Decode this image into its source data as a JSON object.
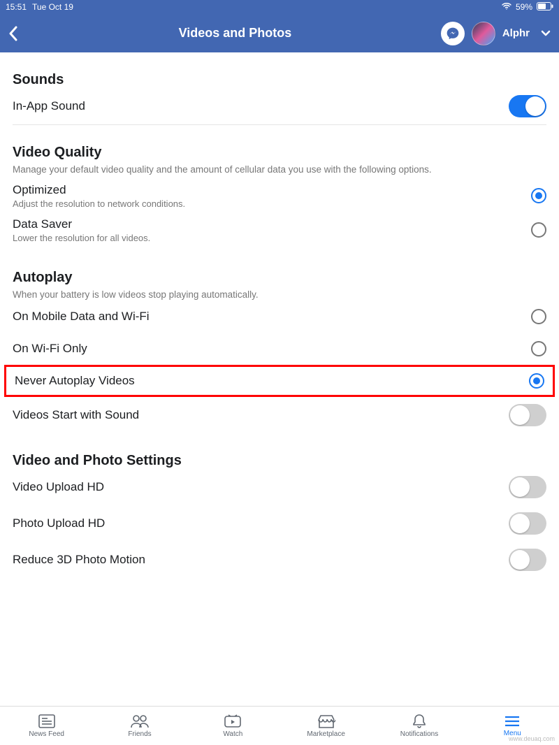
{
  "status": {
    "time": "15:51",
    "date": "Tue Oct 19",
    "battery": "59%"
  },
  "nav": {
    "title": "Videos and Photos",
    "profile_name": "Alphr"
  },
  "sections": {
    "sounds": {
      "title": "Sounds",
      "in_app_sound": "In-App Sound"
    },
    "video_quality": {
      "title": "Video Quality",
      "description": "Manage your default video quality and the amount of cellular data you use with the following options.",
      "optimized_label": "Optimized",
      "optimized_desc": "Adjust the resolution to network conditions.",
      "datasaver_label": "Data Saver",
      "datasaver_desc": "Lower the resolution for all videos."
    },
    "autoplay": {
      "title": "Autoplay",
      "description": "When your battery is low videos stop playing automatically.",
      "mobile_wifi": "On Mobile Data and Wi-Fi",
      "wifi_only": "On Wi-Fi Only",
      "never": "Never Autoplay Videos",
      "start_with_sound": "Videos Start with Sound"
    },
    "video_photo_settings": {
      "title": "Video and Photo Settings",
      "video_upload_hd": "Video Upload HD",
      "photo_upload_hd": "Photo Upload HD",
      "reduce_3d": "Reduce 3D Photo Motion"
    }
  },
  "tabs": {
    "news_feed": "News Feed",
    "friends": "Friends",
    "watch": "Watch",
    "marketplace": "Marketplace",
    "notifications": "Notifications",
    "menu": "Menu"
  },
  "state": {
    "in_app_sound_on": true,
    "video_quality_selected": "optimized",
    "autoplay_selected": "never",
    "videos_start_with_sound": false,
    "video_upload_hd": false,
    "photo_upload_hd": false,
    "reduce_3d": false,
    "active_tab": "menu"
  },
  "colors": {
    "brand_blue": "#4267B2",
    "accent_blue": "#1877F2",
    "highlight_red": "#ff0000"
  },
  "watermark": "www.deuaq.com"
}
